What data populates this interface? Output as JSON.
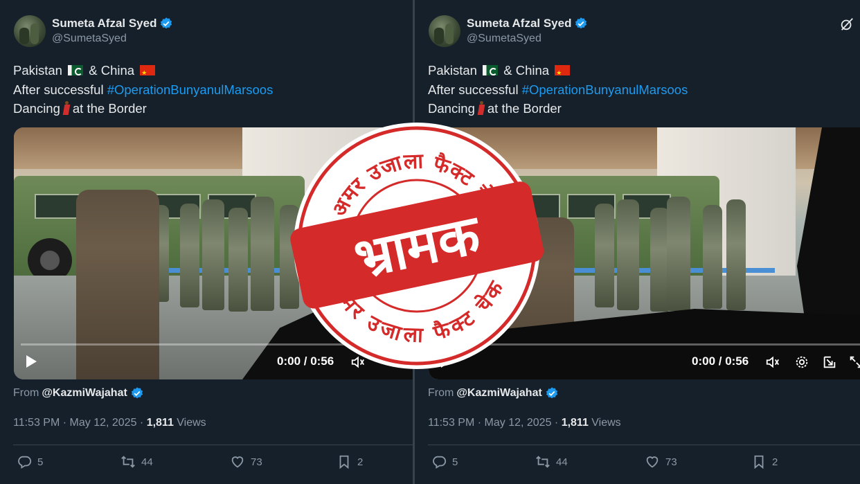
{
  "tweet": {
    "display_name": "Sumeta Afzal Syed",
    "handle": "@SumetaSyed",
    "line1_a": "Pakistan",
    "line1_b": "& China",
    "line2_a": "After successful",
    "line2_hashtag": "#OperationBunyanulMarsoos",
    "line3_a": "Dancing",
    "line3_b": "at the Border",
    "video_time": "0:00 / 0:56",
    "from_label": "From",
    "from_handle": "@KazmiWajahat",
    "timestamp": "11:53 PM · May 12, 2025 · ",
    "views_count": "1,811",
    "views_label": " Views",
    "replies": "5",
    "retweets": "44",
    "likes": "73",
    "bookmarks": "2"
  },
  "stamp": {
    "top_text": "अमर उजाला फैक्ट चेक",
    "bottom_text": "अमर उजाला फैक्ट चेक",
    "verdict": "भ्रामक"
  },
  "colors": {
    "background": "#15202b",
    "link": "#1d9bf0",
    "stamp_red": "#d42a2a"
  },
  "icons": [
    "verified-badge-icon",
    "grok-icon",
    "play-icon",
    "volume-icon",
    "settings-icon",
    "fullscreen-icon",
    "reply-icon",
    "retweet-icon",
    "like-icon",
    "bookmark-icon"
  ]
}
